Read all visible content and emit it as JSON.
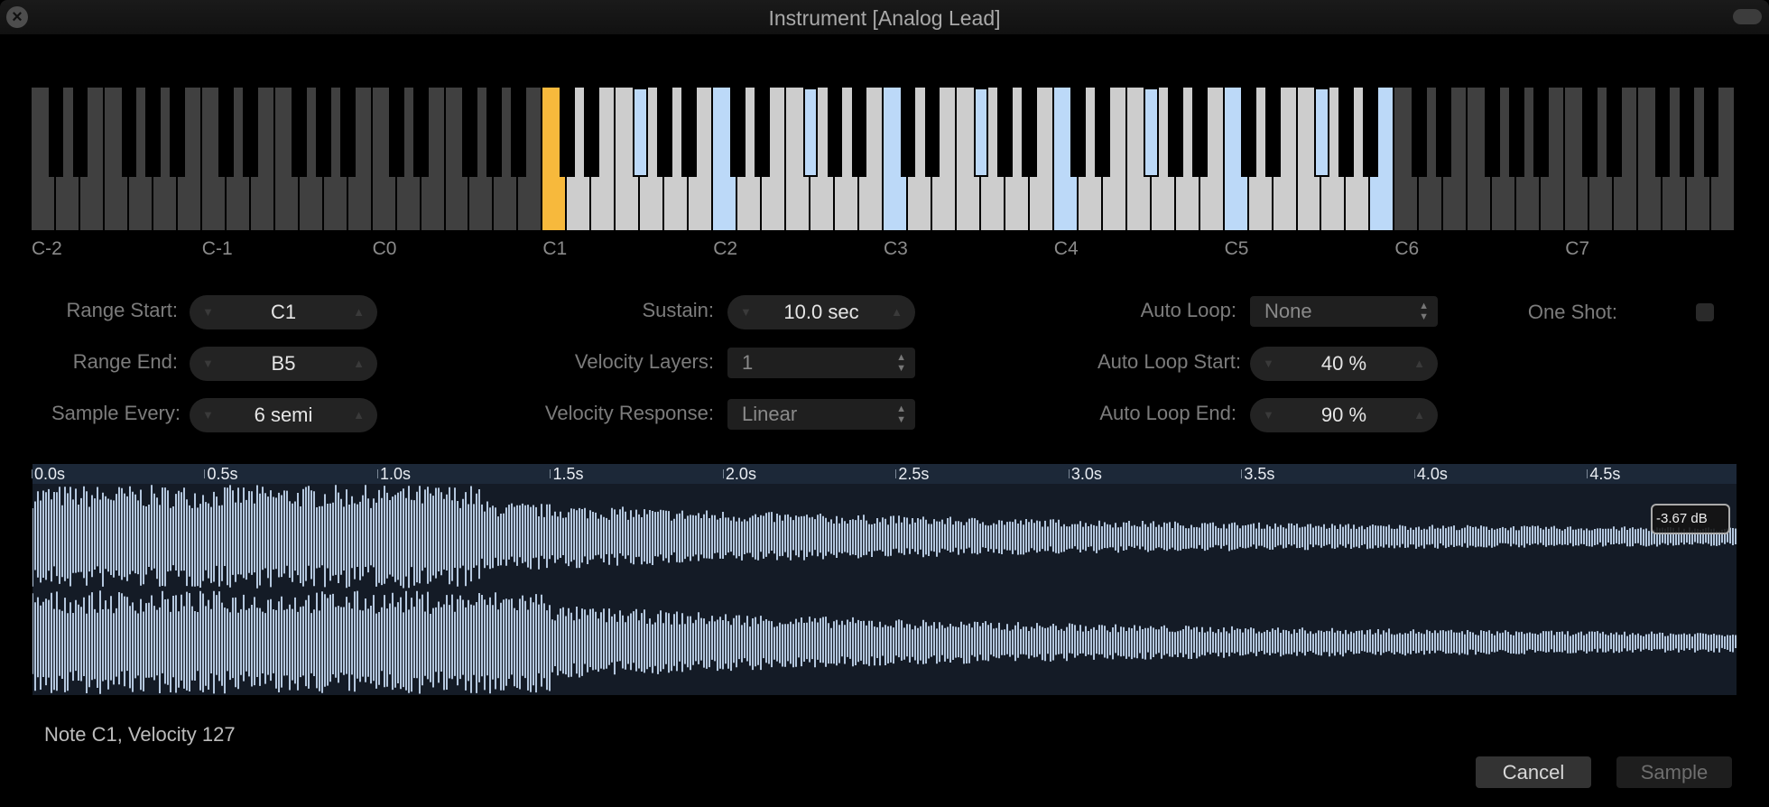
{
  "window": {
    "title": "Instrument [Analog Lead]",
    "close_icon": "close-icon",
    "zoom_icon": "window-pill-button"
  },
  "keyboard": {
    "lowest_octave": -2,
    "octaves": 10,
    "octave_labels": [
      "C-2",
      "C-1",
      "C0",
      "C1",
      "C2",
      "C3",
      "C4",
      "C5",
      "C6",
      "C7"
    ],
    "current_note": "C1",
    "range_start": "C1",
    "range_end": "B5",
    "sampled_notes": [
      "F#1",
      "C2",
      "F#2",
      "C3",
      "F#3",
      "C4",
      "F#4",
      "C5",
      "F#5",
      "B5"
    ],
    "colors": {
      "out_of_range_white": "#404040",
      "in_range_white": "#cdcdcd",
      "current": "#f7b93c",
      "sampled": "#bcd9f8",
      "black": "#000000"
    }
  },
  "controls": {
    "range_start": {
      "label": "Range Start:",
      "value": "C1"
    },
    "range_end": {
      "label": "Range End:",
      "value": "B5"
    },
    "sample_every": {
      "label": "Sample Every:",
      "value": "6 semi"
    },
    "sustain": {
      "label": "Sustain:",
      "value": "10.0 sec"
    },
    "velocity_layers": {
      "label": "Velocity Layers:",
      "value": "1"
    },
    "velocity_response": {
      "label": "Velocity Response:",
      "value": "Linear"
    },
    "auto_loop": {
      "label": "Auto Loop:",
      "value": "None"
    },
    "auto_loop_start": {
      "label": "Auto Loop Start:",
      "value": "40 %"
    },
    "auto_loop_end": {
      "label": "Auto Loop End:",
      "value": "90 %"
    },
    "one_shot": {
      "label": "One Shot:",
      "checked": false
    },
    "stepper_down": "▼",
    "stepper_up": "▲",
    "select_arrows": "▲\n▼"
  },
  "waveform": {
    "ruler_ticks": [
      "0.0s",
      "0.5s",
      "1.0s",
      "1.5s",
      "2.0s",
      "2.5s",
      "3.0s",
      "3.5s",
      "4.0s",
      "4.5s"
    ],
    "duration_s": 4.93,
    "channels": 2,
    "peak_label": "-3.67 dB",
    "wave_color": "#b4c7de",
    "background": "#141b26"
  },
  "status": "Note C1, Velocity 127",
  "buttons": {
    "cancel": "Cancel",
    "sample": "Sample"
  }
}
